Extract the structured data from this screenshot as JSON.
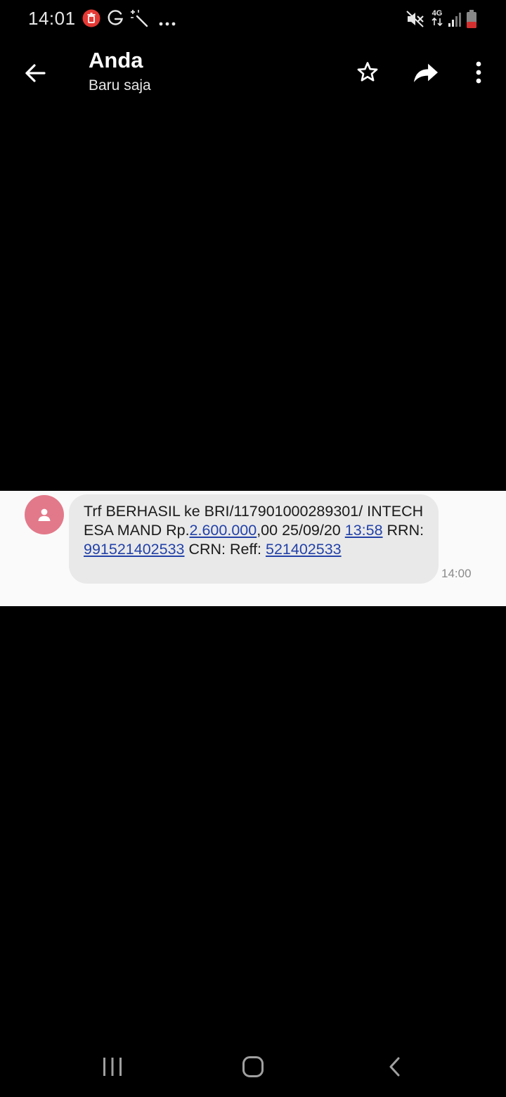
{
  "status_bar": {
    "time": "14:01",
    "network_label": "4G",
    "icons": [
      "delete-notification-icon",
      "google-icon",
      "magic-wand-icon",
      "more-notifications-icon",
      "mute-icon",
      "network-4g-icon",
      "signal-icon",
      "battery-icon"
    ]
  },
  "header": {
    "title": "Anda",
    "subtitle": "Baru saja",
    "actions": [
      "star-icon",
      "forward-icon",
      "more-vert-icon"
    ]
  },
  "message": {
    "parts": {
      "p1": "Trf BERHASIL ke BRI/117901000289301/ INTECH ESA MAND Rp.",
      "amount_link": "2.600.000",
      "p2": ",00 25/09/20 ",
      "time_link": "13:58",
      "p3": " RRN:",
      "rrn_link": "991521402533",
      "p4": " CRN: Reff: ",
      "reff_link": "521402533"
    },
    "time": "14:00"
  },
  "nav_bar": {
    "buttons": [
      "recent-apps-icon",
      "home-icon",
      "back-nav-icon"
    ]
  },
  "colors": {
    "background": "#000000",
    "bubble": "#e9e9e9",
    "avatar": "#e2798a",
    "link": "#2342a8"
  }
}
